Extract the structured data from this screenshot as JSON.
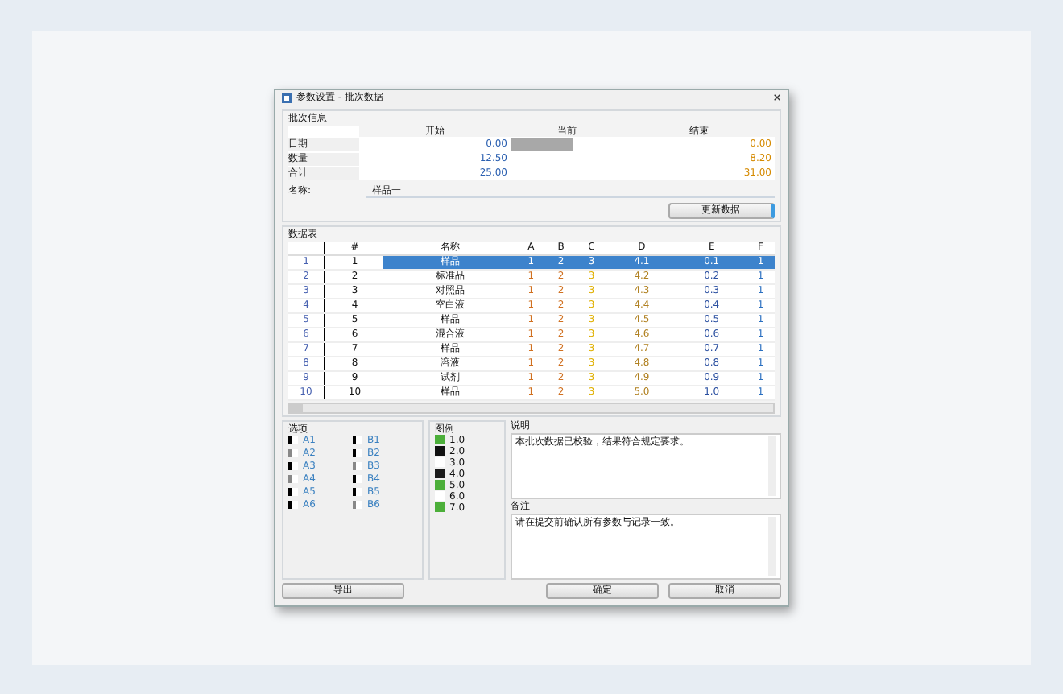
{
  "window": {
    "title": "参数设置 - 批次数据"
  },
  "summary": {
    "title": "批次信息",
    "columns": [
      "开始",
      "当前",
      "结束"
    ],
    "rows": [
      {
        "label": "日期",
        "start": "0.00",
        "level": 0.55,
        "end": "0.00"
      },
      {
        "label": "数量",
        "start": "12.50",
        "end": "8.20"
      },
      {
        "label": "合计",
        "start": "25.00",
        "end": "31.00"
      }
    ],
    "field": {
      "label": "名称:",
      "value": "样品一"
    },
    "button": "更新数据"
  },
  "table": {
    "title": "数据表",
    "columns": [
      "#",
      "名称",
      "A",
      "B",
      "C",
      "D",
      "E",
      "F"
    ],
    "rows": [
      {
        "head": "1",
        "cells": [
          "1",
          "样品",
          "1",
          "2",
          "3",
          "4.1",
          "0.1",
          "1"
        ],
        "selected": true
      },
      {
        "head": "2",
        "cells": [
          "2",
          "标准品",
          "1",
          "2",
          "3",
          "4.2",
          "0.2",
          "1"
        ],
        "selected": false
      },
      {
        "head": "3",
        "cells": [
          "3",
          "对照品",
          "1",
          "2",
          "3",
          "4.3",
          "0.3",
          "1"
        ],
        "selected": false
      },
      {
        "head": "4",
        "cells": [
          "4",
          "空白液",
          "1",
          "2",
          "3",
          "4.4",
          "0.4",
          "1"
        ],
        "selected": false
      },
      {
        "head": "5",
        "cells": [
          "5",
          "样品",
          "1",
          "2",
          "3",
          "4.5",
          "0.5",
          "1"
        ],
        "selected": false
      },
      {
        "head": "6",
        "cells": [
          "6",
          "混合液",
          "1",
          "2",
          "3",
          "4.6",
          "0.6",
          "1"
        ],
        "selected": false
      },
      {
        "head": "7",
        "cells": [
          "7",
          "样品",
          "1",
          "2",
          "3",
          "4.7",
          "0.7",
          "1"
        ],
        "selected": false
      },
      {
        "head": "8",
        "cells": [
          "8",
          "溶液",
          "1",
          "2",
          "3",
          "4.8",
          "0.8",
          "1"
        ],
        "selected": false
      },
      {
        "head": "9",
        "cells": [
          "9",
          "试剂",
          "1",
          "2",
          "3",
          "4.9",
          "0.9",
          "1"
        ],
        "selected": false
      },
      {
        "head": "10",
        "cells": [
          "10",
          "样品",
          "1",
          "2",
          "3",
          "5.0",
          "1.0",
          "1"
        ],
        "selected": false
      }
    ]
  },
  "options": {
    "title": "选项",
    "items": [
      {
        "label": "A1",
        "checked": true
      },
      {
        "label": "B1",
        "checked": true
      },
      {
        "label": "A2",
        "checked": false
      },
      {
        "label": "B2",
        "checked": true
      },
      {
        "label": "A3",
        "checked": true
      },
      {
        "label": "B3",
        "checked": false
      },
      {
        "label": "A4",
        "checked": false
      },
      {
        "label": "B4",
        "checked": true
      },
      {
        "label": "A5",
        "checked": true
      },
      {
        "label": "B5",
        "checked": true
      },
      {
        "label": "A6",
        "checked": true
      },
      {
        "label": "B6",
        "checked": false
      }
    ]
  },
  "legend": {
    "title": "图例",
    "items": [
      {
        "label": "1.0",
        "color": "#4caf3a"
      },
      {
        "label": "2.0",
        "color": "#111111"
      },
      {
        "label": "3.0",
        "color": "#ffffff"
      },
      {
        "label": "4.0",
        "color": "#1a1a1a"
      },
      {
        "label": "5.0",
        "color": "#4caf3a"
      },
      {
        "label": "6.0",
        "color": "#ffffff"
      },
      {
        "label": "7.0",
        "color": "#4caf3a"
      }
    ]
  },
  "notes": [
    {
      "title": "说明",
      "text": "本批次数据已校验，结果符合规定要求。"
    },
    {
      "title": "备注",
      "text": "请在提交前确认所有参数与记录一致。"
    }
  ],
  "buttons": [
    {
      "label": "导出"
    },
    {
      "label": "确定"
    },
    {
      "label": "取消"
    }
  ]
}
